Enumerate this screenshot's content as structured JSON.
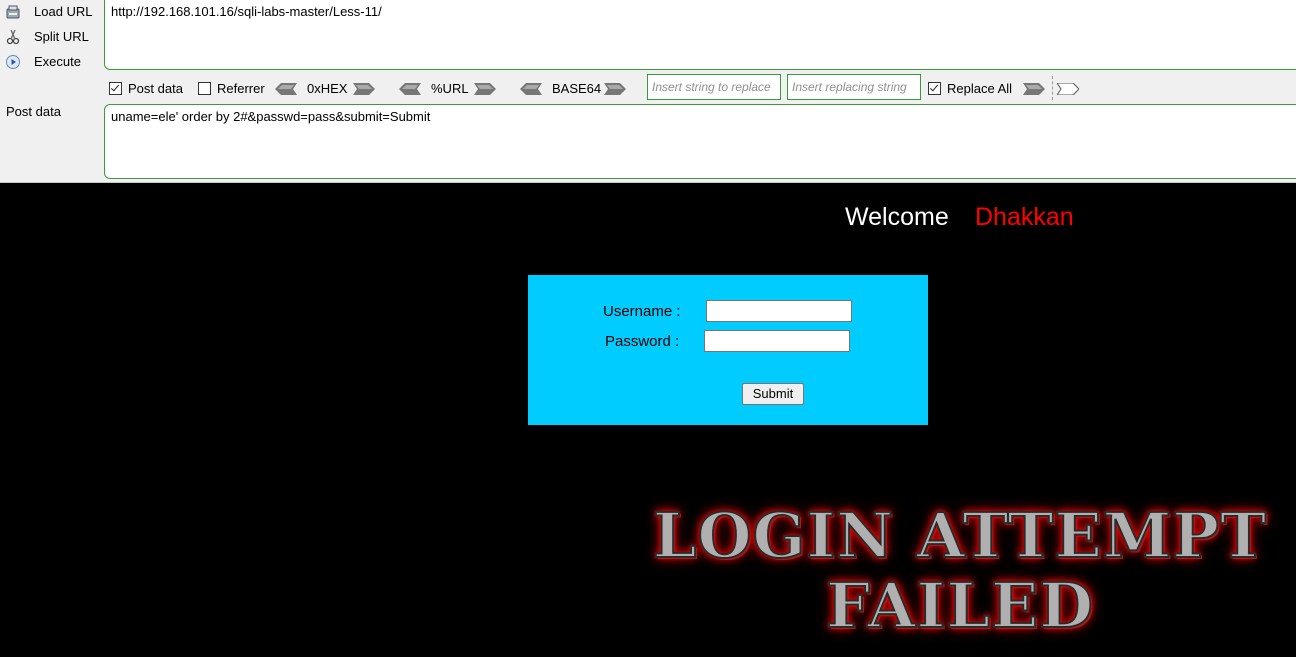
{
  "hackbar": {
    "actions": [
      {
        "label": "Load URL",
        "icon": "load-url-icon"
      },
      {
        "label": "Split URL",
        "icon": "scissors-icon"
      },
      {
        "label": "Execute",
        "icon": "play-icon"
      }
    ],
    "url": "http://192.168.101.16/sqli-labs-master/Less-11/",
    "options": {
      "post_data_label": "Post data",
      "post_data_checked": true,
      "referrer_label": "Referrer",
      "referrer_checked": false,
      "hex_label": "0xHEX",
      "url_label": "%URL",
      "base64_label": "BASE64",
      "insert_string_placeholder": "Insert string to replace",
      "insert_replacing_placeholder": "Insert replacing string",
      "replace_all_label": "Replace All",
      "replace_all_checked": true
    },
    "post_label": "Post data",
    "post_value": "uname=ele' order by 2#&passwd=pass&submit=Submit"
  },
  "page": {
    "welcome": "Welcome",
    "welcome_name": "Dhakkan",
    "form": {
      "username_label": "Username :",
      "password_label": "Password :",
      "username_value": "",
      "password_value": "",
      "submit_label": "Submit"
    },
    "banner_line1": "LOGIN ATTEMPT",
    "banner_line2": "FAILED"
  },
  "colors": {
    "form_bg": "#00ccff",
    "page_bg": "#000000",
    "accent_red": "#ff0000",
    "border_green": "#3c9a3c"
  }
}
